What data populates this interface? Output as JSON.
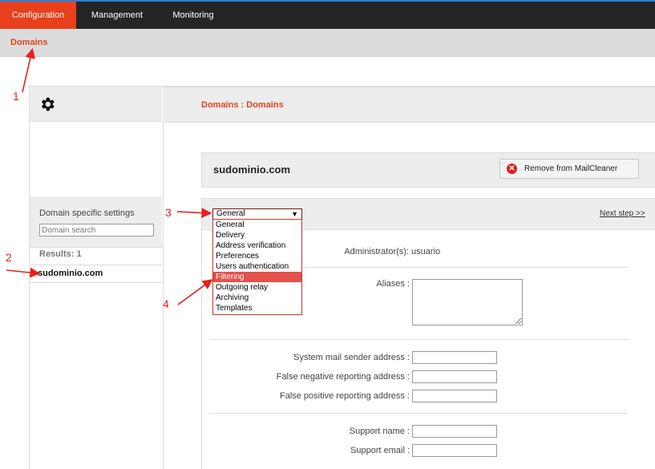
{
  "nav": {
    "items": [
      {
        "label": "Configuration",
        "active": true
      },
      {
        "label": "Management",
        "active": false
      },
      {
        "label": "Monitoring",
        "active": false
      }
    ]
  },
  "subnav": {
    "crumb": "Domains"
  },
  "header": {
    "title": "Domains : Domains"
  },
  "sidebar": {
    "title": "Domain specific settings",
    "search_placeholder": "Domain search",
    "results": "Results: 1",
    "domain": "sudominio.com"
  },
  "domain": {
    "name": "sudominio.com",
    "remove_label": "Remove from MailCleaner"
  },
  "step": {
    "selected": "General",
    "next_label": "Next step >>",
    "options": [
      "General",
      "Delivery",
      "Address verification",
      "Preferences",
      "Users authentication",
      "Filtering",
      "Outgoing relay",
      "Archiving",
      "Templates"
    ],
    "highlighted": "Filtering"
  },
  "form": {
    "admin_label": "Administrator(s):",
    "admin_value": "usuario",
    "aliases_label": "Aliases :",
    "system_sender_label": "System mail sender address :",
    "false_negative_label": "False negative reporting address :",
    "false_positive_label": "False positive reporting address :",
    "support_name_label": "Support name :",
    "support_email_label": "Support email :"
  },
  "annotations": [
    "1",
    "2",
    "3",
    "4"
  ],
  "colors": {
    "accent": "#e8401c",
    "nav_bg": "#252525",
    "annotation": "#e8201b"
  }
}
